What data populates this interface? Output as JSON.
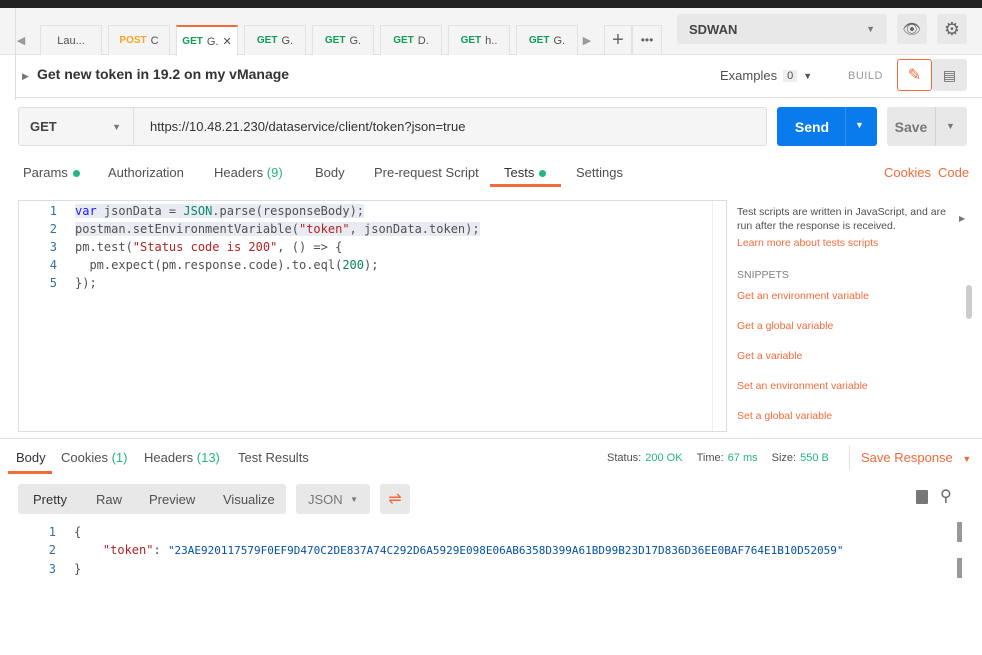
{
  "tabs": [
    {
      "method": "",
      "label": "Lau..."
    },
    {
      "method": "POST",
      "label": "C"
    },
    {
      "method": "GET",
      "label": "G.",
      "active": true
    },
    {
      "method": "GET",
      "label": "G."
    },
    {
      "method": "GET",
      "label": "G."
    },
    {
      "method": "GET",
      "label": "D."
    },
    {
      "method": "GET",
      "label": "h.."
    },
    {
      "method": "GET",
      "label": "G."
    }
  ],
  "environment": "SDWAN",
  "request": {
    "title": "Get new token in 19.2 on my vManage",
    "examples_label": "Examples",
    "examples_count": "0",
    "build_label": "BUILD",
    "method": "GET",
    "url": "https://10.48.21.230/dataservice/client/token?json=true",
    "send": "Send",
    "save": "Save"
  },
  "req_tabs": {
    "params": "Params",
    "authorization": "Authorization",
    "headers": "Headers",
    "headers_count": "(9)",
    "body": "Body",
    "prerequest": "Pre-request Script",
    "tests": "Tests",
    "settings": "Settings",
    "cookies": "Cookies",
    "code": "Code"
  },
  "editor_lines": [
    "1",
    "2",
    "3",
    "4",
    "5"
  ],
  "code": {
    "l1a": "var",
    "l1b": " jsonData = ",
    "l1c": "JSON",
    "l1d": ".parse(responseBody);",
    "l2a": "postman.setEnvironmentVariable(",
    "l2b": "\"token\"",
    "l2c": ", jsonData.token);",
    "l3a": "pm.test(",
    "l3b": "\"Status code is 200\"",
    "l3c": ", () => {",
    "l4a": "  pm.expect(pm.response.code).to.eql(",
    "l4b": "200",
    "l4c": ");",
    "l5": "});"
  },
  "side": {
    "desc": "Test scripts are written in JavaScript, and are run after the response is received.",
    "learn": "Learn more about tests scripts",
    "snippets_title": "SNIPPETS",
    "snippets": [
      "Get an environment variable",
      "Get a global variable",
      "Get a variable",
      "Set an environment variable",
      "Set a global variable"
    ]
  },
  "response": {
    "body": "Body",
    "cookies": "Cookies",
    "cookies_count": "(1)",
    "headers": "Headers",
    "headers_count": "(13)",
    "test_results": "Test Results",
    "status_label": "Status:",
    "status": "200 OK",
    "time_label": "Time:",
    "time": "67 ms",
    "size_label": "Size:",
    "size": "550 B",
    "save": "Save Response",
    "views": [
      "Pretty",
      "Raw",
      "Preview",
      "Visualize"
    ],
    "format": "JSON",
    "lines": [
      "1",
      "2",
      "3"
    ],
    "open": "{",
    "key": "\"token\"",
    "colon": ": ",
    "value": "\"23AE920117579F0EF9D470C2DE837A74C292D6A5929E098E06AB6358D399A61BD99B23D17D836D36EE0BAF764E1B10D52059\"",
    "close": "}"
  },
  "colors": {
    "accent": "#f26b3a",
    "send": "#097bed",
    "success": "#26b47f"
  }
}
